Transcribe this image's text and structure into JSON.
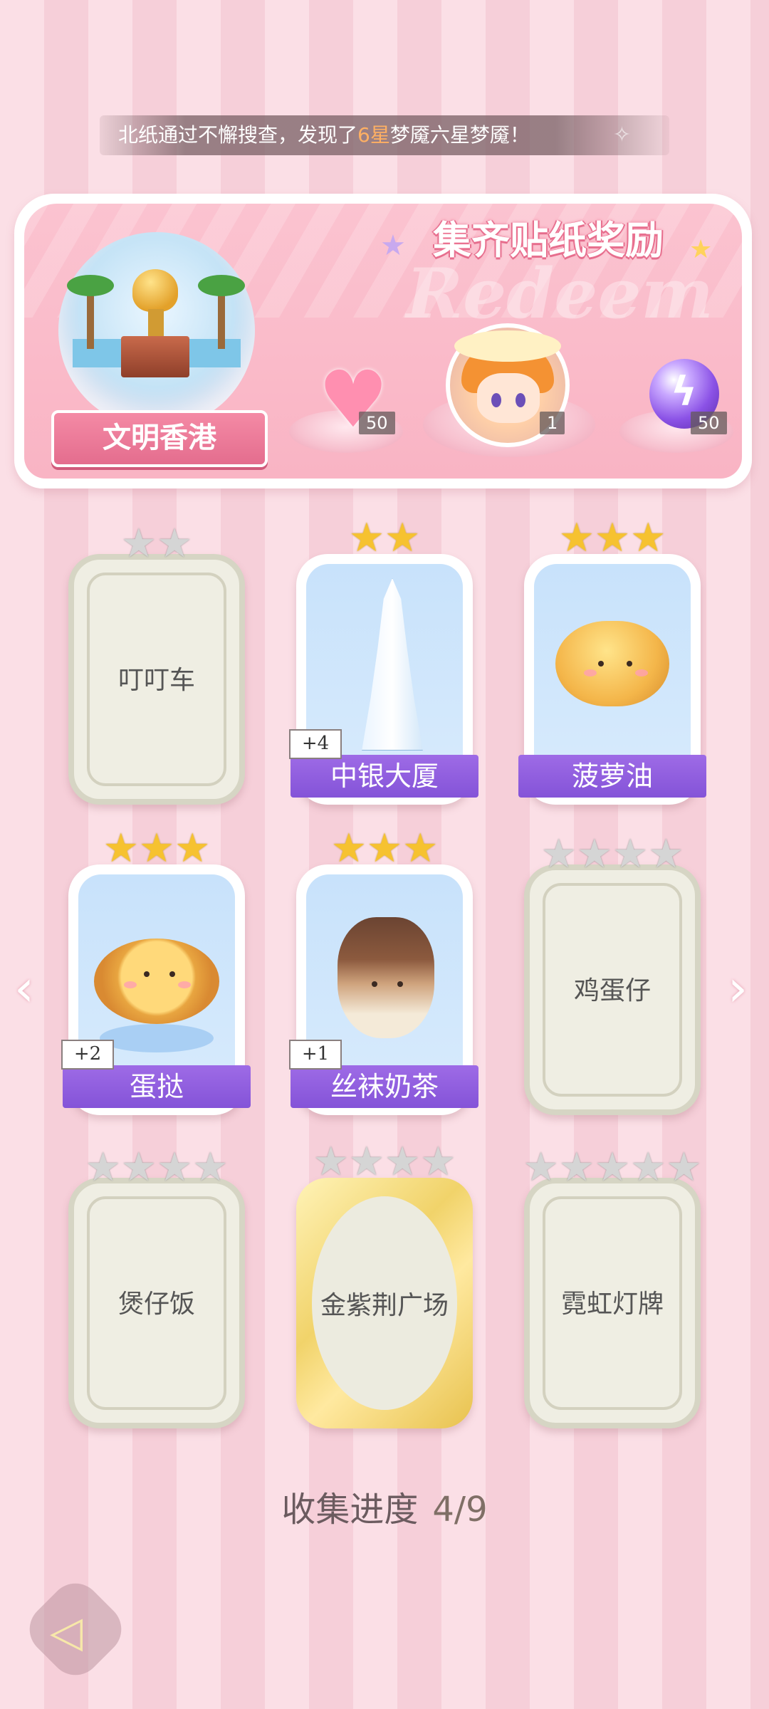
{
  "notice": {
    "prefix": "北纸通过不懈搜查，发现了",
    "highlight": "6星",
    "suffix": "梦魇六星梦魇！"
  },
  "reward": {
    "title": "集齐贴纸奖励",
    "watermark": "Redeem",
    "location": "文明香港",
    "items": [
      {
        "icon": "heart-gem-icon",
        "count": "50"
      },
      {
        "icon": "character-avatar-icon",
        "count": "1"
      },
      {
        "icon": "lightning-orb-icon",
        "count": "50"
      }
    ]
  },
  "stickers": [
    {
      "name": "叮叮车",
      "stars": 2,
      "collected": false
    },
    {
      "name": "中银大厦",
      "stars": 2,
      "collected": true,
      "extra": "+4"
    },
    {
      "name": "菠萝油",
      "stars": 3,
      "collected": true
    },
    {
      "name": "蛋挞",
      "stars": 3,
      "collected": true,
      "extra": "+2"
    },
    {
      "name": "丝袜奶茶",
      "stars": 3,
      "collected": true,
      "extra": "+1"
    },
    {
      "name": "鸡蛋仔",
      "stars": 4,
      "collected": false
    },
    {
      "name": "煲仔饭",
      "stars": 4,
      "collected": false
    },
    {
      "name": "金紫荆广场",
      "stars": 4,
      "collected": false
    },
    {
      "name": "霓虹灯牌",
      "stars": 5,
      "collected": false
    }
  ],
  "progress": {
    "label": "收集进度",
    "value": "4/9"
  },
  "nav": {
    "prev_icon": "chevron-left-icon",
    "next_icon": "chevron-right-icon",
    "back_icon": "back-icon"
  },
  "colors": {
    "accent_pink": "#f48aa5",
    "ribbon_purple": "#8453d8",
    "star_gold": "#f6c230",
    "highlight_orange": "#ffb063"
  }
}
